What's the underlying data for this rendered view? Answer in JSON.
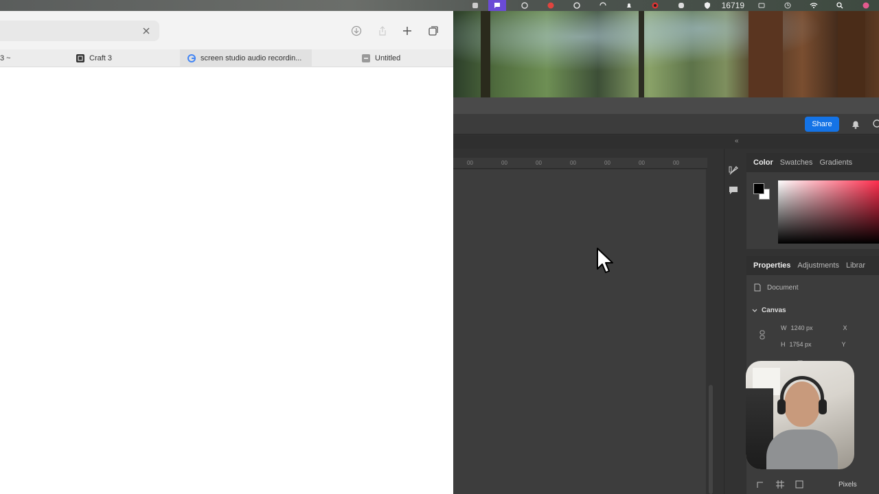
{
  "menubar": {
    "status_count": "16719",
    "accent_color": "#6b4bd6"
  },
  "safari": {
    "tabs": [
      {
        "label": "3 ~",
        "icon": "generic-page-icon"
      },
      {
        "label": "Craft 3",
        "icon": "craft-app-icon"
      },
      {
        "label": "screen studio audio recordin...",
        "icon": "google-icon"
      },
      {
        "label": "Untitled",
        "icon": "document-icon"
      }
    ]
  },
  "photoshop": {
    "share_label": "Share",
    "share_color": "#1473e6",
    "ruler_ticks": [
      "00",
      "00",
      "00",
      "00",
      "00",
      "00",
      "00"
    ],
    "color_panel": {
      "tabs": [
        "Color",
        "Swatches",
        "Gradients"
      ]
    },
    "properties_panel": {
      "tabs": [
        "Properties",
        "Adjustments",
        "Librar"
      ],
      "document_label": "Document",
      "section_label": "Canvas",
      "width_label": "W",
      "width_value": "1240 px",
      "x_label": "X",
      "height_label": "H",
      "height_value": "1754 px",
      "y_label": "Y",
      "units_value": "Pixels"
    }
  }
}
